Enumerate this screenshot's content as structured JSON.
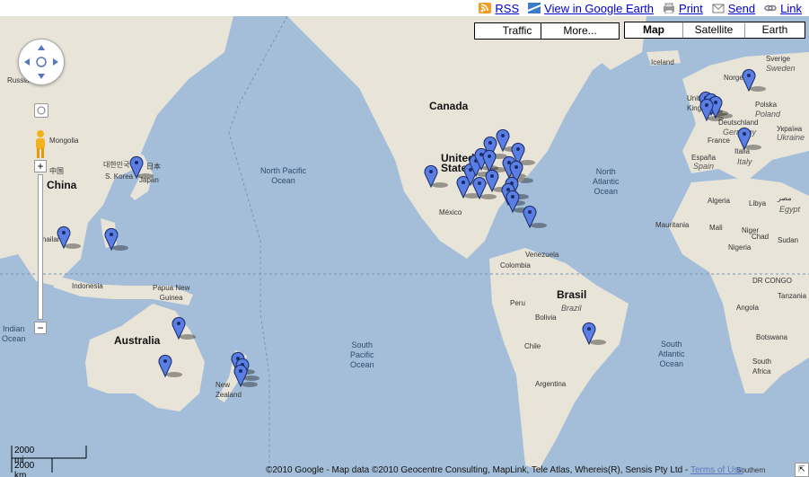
{
  "toolbar": {
    "rss": "RSS",
    "earth": "View in Google Earth",
    "print": "Print",
    "send": "Send",
    "link": "Link"
  },
  "map": {
    "traffic": "Traffic",
    "more": "More...",
    "types": [
      "Map",
      "Satellite",
      "Earth"
    ],
    "selected_type": "Map",
    "scale_mi": "2000 mi",
    "scale_km": "2000 km",
    "copyright": "©2010 Google - Map data ©2010 Geocentre Consulting, MapLink, Tele Atlas, Whereis(R), Sensis Pty Ltd - ",
    "terms": "Terms of Use",
    "labels": {
      "russia": "Russia",
      "mongolia": "Mongolia",
      "china_zh": "中国",
      "china": "China",
      "korea_ko": "대한민국",
      "south_korea": "S. Korea",
      "japan_ja": "日本",
      "japan": "Japan",
      "thailand": "Thailand",
      "indonesia": "Indonesia",
      "png": "Papua New\nGuinea",
      "australia": "Australia",
      "nz": "New\nZealand",
      "indian_ocean": "Indian\nOcean",
      "north_pacific": "North Pacific\nOcean",
      "south_pacific": "South\nPacific\nOcean",
      "canada": "Canada",
      "us": "United\nStates",
      "mexico": "México",
      "north_atlantic": "North\nAtlantic\nOcean",
      "south_atlantic": "South\nAtlantic\nOcean",
      "venezuela": "Venezuela",
      "colombia": "Colombia",
      "peru": "Peru",
      "brasil": "Brasil",
      "brazil": "Brazil",
      "bolivia": "Bolivia",
      "chile": "Chile",
      "argentina": "Argentina",
      "iceland": "Iceland",
      "sverige": "Sverige",
      "sweden": "Sweden",
      "norge": "Norge",
      "uk": "United\nKingdom",
      "polska": "Polska",
      "poland": "Poland",
      "deutschland": "Deutschland",
      "germany": "Germany",
      "ukraine": "Україна",
      "ukraine_en": "Ukraine",
      "france": "France",
      "espana": "España",
      "spain": "Spain",
      "italia": "Italia",
      "italy": "Italy",
      "algeria": "Algeria",
      "libya": "Libya",
      "misr": "مصر",
      "egypt": "Egypt",
      "mauritania": "Mauritania",
      "mali": "Mali",
      "niger": "Niger",
      "chad": "Chad",
      "sudan": "Sudan",
      "nigeria": "Nigeria",
      "drcongo": "DR CONGO",
      "tanzania": "Tanzania",
      "angola": "Angola",
      "botswana": "Botswana",
      "south_africa": "South\nAfrica",
      "southern": "Southern"
    }
  }
}
